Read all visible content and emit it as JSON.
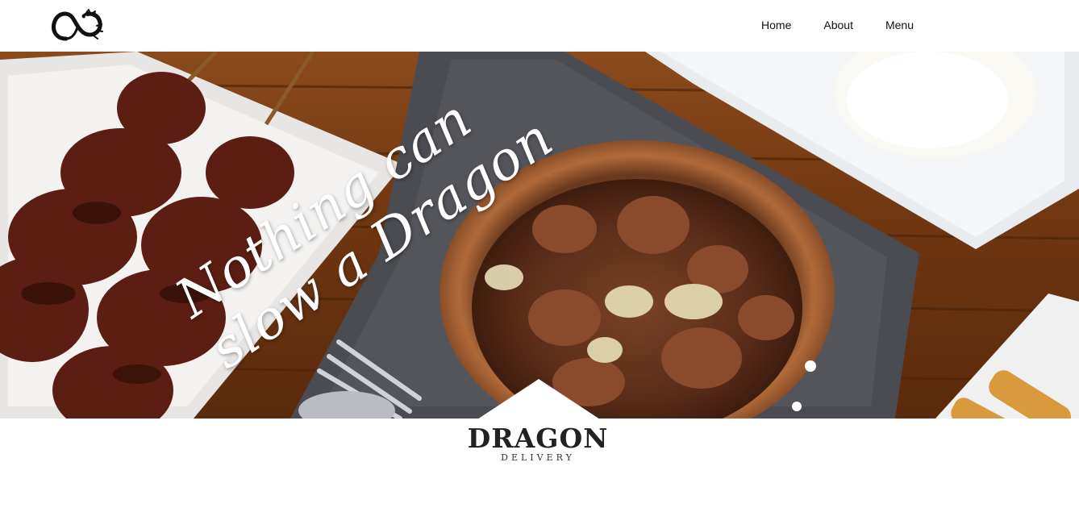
{
  "nav": {
    "logo_icon": "dragon-ouroboros-icon",
    "links": [
      {
        "label": "Home"
      },
      {
        "label": "About"
      },
      {
        "label": "Menu"
      }
    ]
  },
  "hero": {
    "headline_line1": "Nothing can",
    "headline_line2": "slow a Dragon",
    "image": "grilled-meat-skewers-and-braised-meat-bowl-photo"
  },
  "brand": {
    "name": "DRAGON",
    "subtitle": "DELIVERY"
  },
  "colors": {
    "background": "#ffffff",
    "text": "#111111",
    "wood": "#7a3e16",
    "brand_text": "#222222"
  }
}
